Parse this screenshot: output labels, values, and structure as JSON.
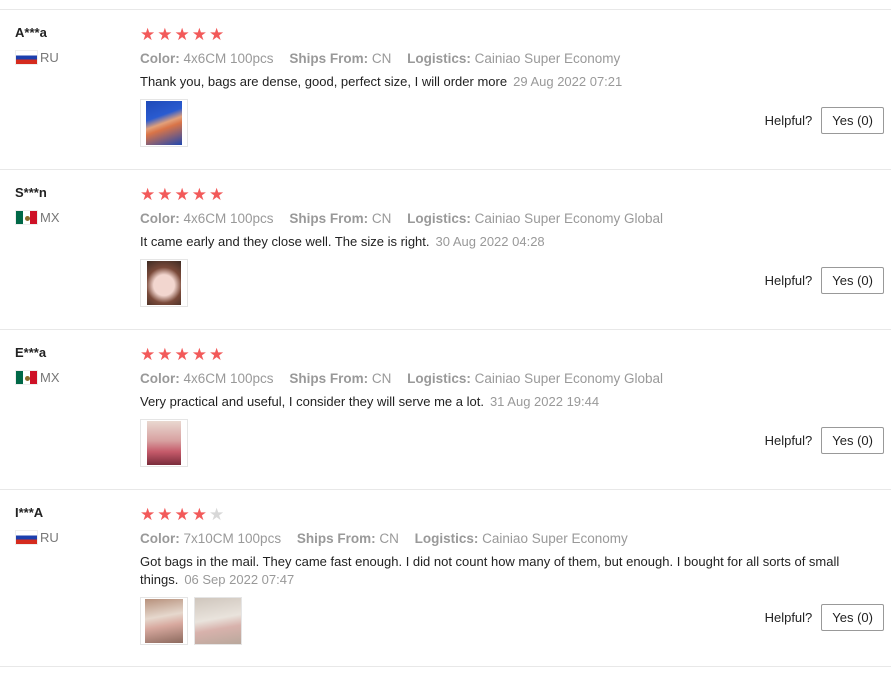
{
  "labels": {
    "color": "Color:",
    "ships_from": "Ships From:",
    "logistics": "Logistics:",
    "helpful": "Helpful?"
  },
  "colors": {
    "star_on": "#f25a5a",
    "star_off": "#d8d8d8"
  },
  "reviews": [
    {
      "user": "A***a",
      "country": "RU",
      "rating": 5,
      "color": "4x6CM 100pcs",
      "ships_from": "CN",
      "logistics": "Cainiao Super Economy",
      "text": "Thank you, bags are dense, good, perfect size, I will order more",
      "date": "29 Aug 2022 07:21",
      "yes_label": "Yes (0)"
    },
    {
      "user": "S***n",
      "country": "MX",
      "rating": 5,
      "color": "4x6CM 100pcs",
      "ships_from": "CN",
      "logistics": "Cainiao Super Economy Global",
      "text": "It came early and they close well. The size is right.",
      "date": "30 Aug 2022 04:28",
      "yes_label": "Yes (0)"
    },
    {
      "user": "E***a",
      "country": "MX",
      "rating": 5,
      "color": "4x6CM 100pcs",
      "ships_from": "CN",
      "logistics": "Cainiao Super Economy Global",
      "text": "Very practical and useful, I consider they will serve me a lot.",
      "date": "31 Aug 2022 19:44",
      "yes_label": "Yes (0)"
    },
    {
      "user": "I***A",
      "country": "RU",
      "rating": 4,
      "color": "7x10CM 100pcs",
      "ships_from": "CN",
      "logistics": "Cainiao Super Economy",
      "text": "Got bags in the mail. They came fast enough. I did not count how many of them, but enough. I bought for all sorts of small things.",
      "date": "06 Sep 2022 07:47",
      "yes_label": "Yes (0)"
    }
  ]
}
